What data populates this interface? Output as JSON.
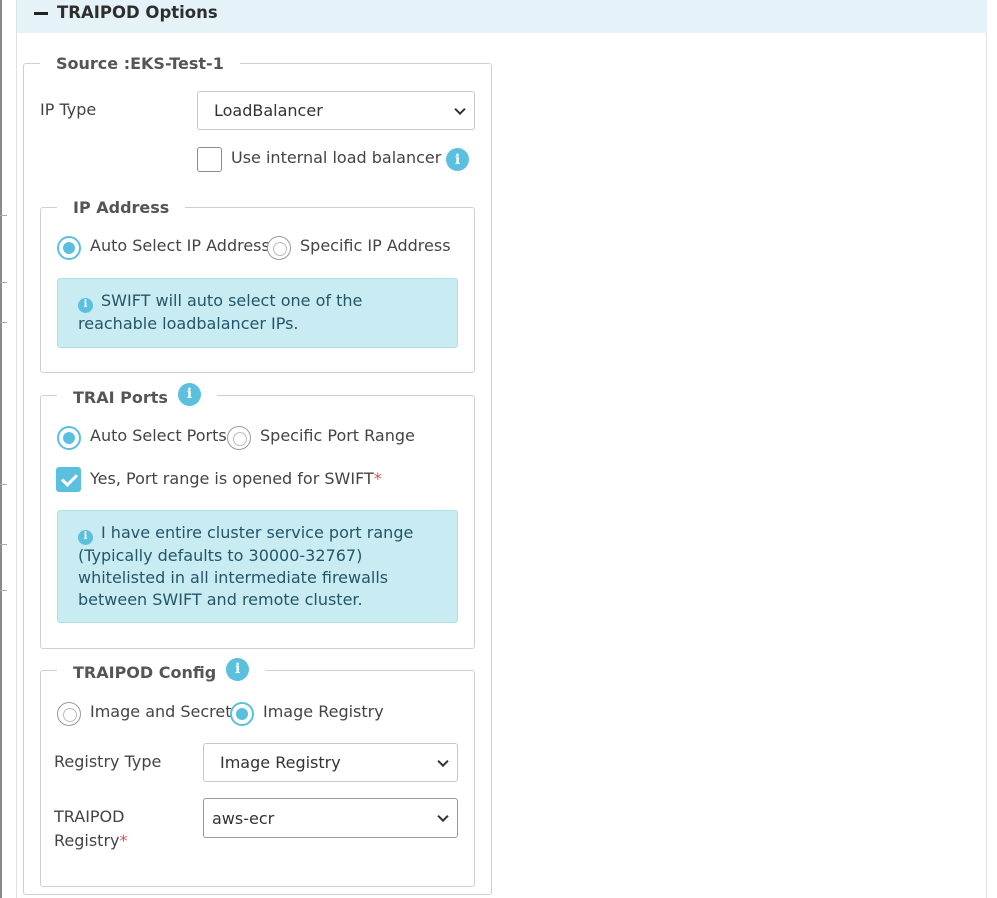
{
  "panel": {
    "title": "TRAIPOD Options"
  },
  "source": {
    "legend": "Source :EKS-Test-1"
  },
  "ip_type": {
    "label": "IP Type",
    "value": "LoadBalancer"
  },
  "internal_lb": {
    "label": "Use internal load balancer",
    "checked": false
  },
  "ip_address": {
    "legend": "IP Address",
    "options": [
      "Auto Select IP Address",
      "Specific IP Address"
    ],
    "selected": "Auto Select IP Address",
    "info_text": "SWIFT will auto select one of the reachable loadbalancer IPs."
  },
  "trai_ports": {
    "legend": "TRAI Ports",
    "options": [
      "Auto Select Ports",
      "Specific Port Range"
    ],
    "selected": "Auto Select Ports",
    "confirm_label": "Yes, Port range is opened for SWIFT",
    "required_mark": "*",
    "confirm_checked": true,
    "info_text": "I have entire cluster service port range (Typically defaults to 30000-32767) whitelisted in all intermediate firewalls between SWIFT and remote cluster."
  },
  "traipod_config": {
    "legend": "TRAIPOD Config",
    "options": [
      "Image and Secret",
      "Image Registry"
    ],
    "selected": "Image Registry",
    "registry_type_label": "Registry Type",
    "registry_type_value": "Image Registry",
    "registry_label_line1": "TRAIPOD",
    "registry_label_line2": "Registry",
    "required_mark": "*",
    "registry_value": "aws-ecr"
  },
  "icons": {
    "collapse": "minus-icon",
    "info": "info-circle-icon",
    "dropdown": "chevron-down-icon"
  },
  "colors": {
    "accent": "#5bc0de",
    "alert_bg": "#c9ebf2",
    "header_bg": "#e5f3f8",
    "required": "#d9534f"
  }
}
